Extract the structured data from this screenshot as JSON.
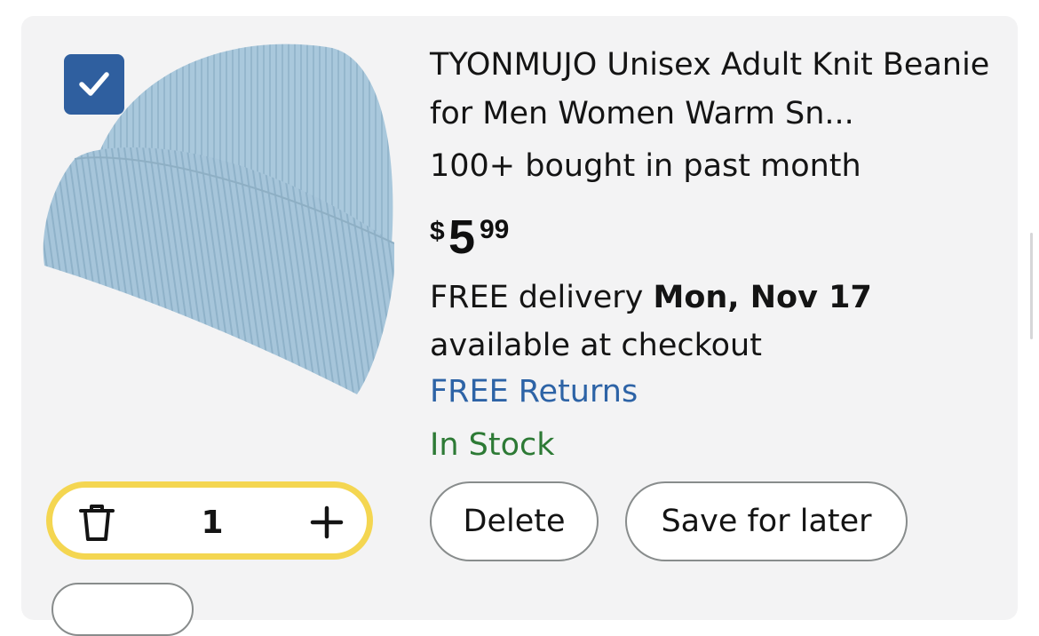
{
  "product": {
    "title": "TYONMUJO Unisex Adult Knit Beanie for Men Women Warm Sn...",
    "bought": "100+ bought in past month",
    "price_symbol": "$",
    "price_whole": "5",
    "price_fraction": "99",
    "delivery_prefix": "FREE delivery ",
    "delivery_date": "Mon, Nov 17",
    "delivery_suffix": " available at checkout",
    "returns": "FREE Returns",
    "stock": "In Stock",
    "selected": true
  },
  "quantity": {
    "value": "1"
  },
  "actions": {
    "delete_label": "Delete",
    "save_label": "Save for later"
  },
  "colors": {
    "card_bg": "#f3f3f4",
    "checkbox": "#2f5f9f",
    "link": "#2d63a6",
    "stock": "#2d7a35",
    "qty_border": "#f4d651",
    "beanie": "#a9c8dc"
  },
  "icons": {
    "checkbox": "checkmark-icon",
    "trash": "trash-icon",
    "plus": "plus-icon"
  }
}
